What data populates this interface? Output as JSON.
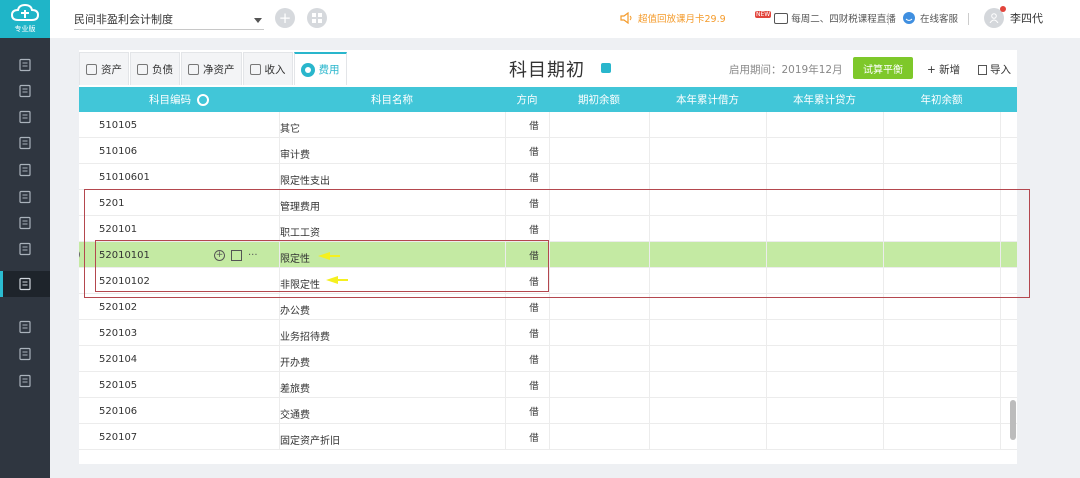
{
  "app": {
    "logo_text": "专业版",
    "system_select": "民间非盈利会计制度",
    "promo_text": "超值回放课月卡29.9",
    "live_badge": "NEW",
    "live_text": "每周二、四财税课程直播",
    "service_text": "在线客服",
    "user_name": "李四代"
  },
  "sidebar": {
    "icons": [
      "ledger-icon",
      "voucher-icon",
      "chart-icon",
      "building-icon",
      "calendar-icon",
      "book-icon",
      "report-icon",
      "invoice-icon",
      "settings-icon",
      "screen-icon",
      "gauge-icon",
      "document-icon"
    ],
    "active_index": 8
  },
  "tabs": [
    {
      "label": "资产",
      "icon": "asset-icon"
    },
    {
      "label": "负债",
      "icon": "liability-icon"
    },
    {
      "label": "净资产",
      "icon": "net-asset-icon"
    },
    {
      "label": "收入",
      "icon": "income-icon"
    },
    {
      "label": "费用",
      "icon": "expense-icon",
      "active": true
    }
  ],
  "page": {
    "title": "科目期初",
    "period_label": "启用期间：",
    "period_value": "2019年12月",
    "trial_balance_label": "试算平衡",
    "add_label": "+ 新增",
    "import_label": "导入"
  },
  "table": {
    "headers": [
      "科目编码",
      "科目名称",
      "方向",
      "期初余额",
      "本年累计借方",
      "本年累计贷方",
      "年初余额"
    ],
    "rows": [
      {
        "code": "510105",
        "name": "其它",
        "dir": "借"
      },
      {
        "code": "510106",
        "name": "审计费",
        "dir": "借"
      },
      {
        "code": "51010601",
        "name": "限定性支出",
        "dir": "借"
      },
      {
        "code": "5201",
        "name": "管理费用",
        "dir": "借"
      },
      {
        "code": "520101",
        "name": "职工工资",
        "dir": "借"
      },
      {
        "code": "52010101",
        "name": "限定性",
        "dir": "借",
        "selected": true
      },
      {
        "code": "52010102",
        "name": "非限定性",
        "dir": "借"
      },
      {
        "code": "520102",
        "name": "办公费",
        "dir": "借"
      },
      {
        "code": "520103",
        "name": "业务招待费",
        "dir": "借"
      },
      {
        "code": "520104",
        "name": "开办费",
        "dir": "借"
      },
      {
        "code": "520105",
        "name": "差旅费",
        "dir": "借"
      },
      {
        "code": "520106",
        "name": "交通费",
        "dir": "借"
      },
      {
        "code": "520107",
        "name": "固定资产折旧",
        "dir": "借"
      }
    ],
    "row_actions": {
      "add_icon": "plus-circle-icon",
      "edit_icon": "edit-icon",
      "more_label": "···"
    },
    "delete_icon": "remove-circle-icon"
  },
  "colors": {
    "accent": "#41c6d8",
    "sidebar": "#2f3640",
    "selected_row": "#c4eaa3",
    "trial_button": "#7ec82a",
    "annotation_box": "#b4474e",
    "annotation_arrow": "#f5f01f"
  }
}
